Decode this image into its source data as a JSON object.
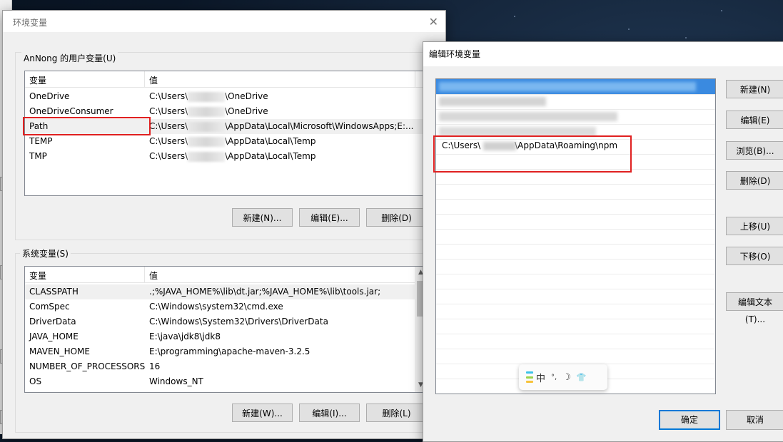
{
  "env_window": {
    "title": "环境变量",
    "close_glyph": "✕",
    "user_group": "AnNong 的用户变量(U)",
    "system_group": "系统变量(S)",
    "col_var": "变量",
    "col_val": "值",
    "user_rows": [
      {
        "name": "OneDrive",
        "pre": "C:\\Users\\",
        "post": "\\OneDrive"
      },
      {
        "name": "OneDriveConsumer",
        "pre": "C:\\Users\\",
        "post": "\\OneDrive"
      },
      {
        "name": "Path",
        "pre": "C:\\Users\\",
        "post": "\\AppData\\Local\\Microsoft\\WindowsApps;E:..."
      },
      {
        "name": "TEMP",
        "pre": "C:\\Users\\",
        "post": "\\AppData\\Local\\Temp"
      },
      {
        "name": "TMP",
        "pre": "C:\\Users\\",
        "post": "\\AppData\\Local\\Temp"
      }
    ],
    "system_rows": [
      {
        "name": "CLASSPATH",
        "value": ".;%JAVA_HOME%\\lib\\dt.jar;%JAVA_HOME%\\lib\\tools.jar;"
      },
      {
        "name": "ComSpec",
        "value": "C:\\Windows\\system32\\cmd.exe"
      },
      {
        "name": "DriverData",
        "value": "C:\\Windows\\System32\\Drivers\\DriverData"
      },
      {
        "name": "JAVA_HOME",
        "value": "E:\\java\\jdk8\\jdk8"
      },
      {
        "name": "MAVEN_HOME",
        "value": "E:\\programming\\apache-maven-3.2.5"
      },
      {
        "name": "NUMBER_OF_PROCESSORS",
        "value": "16"
      },
      {
        "name": "OS",
        "value": "Windows_NT"
      }
    ],
    "user_buttons": {
      "new": "新建(N)...",
      "edit": "编辑(E)...",
      "delete": "删除(D)"
    },
    "system_buttons": {
      "new": "新建(W)...",
      "edit": "编辑(I)...",
      "delete": "删除(L)"
    }
  },
  "edit_window": {
    "title": "编辑环境变量",
    "visible_entry": "C:\\Users\\",
    "visible_entry_post": "\\AppData\\Roaming\\npm",
    "buttons": {
      "new": "新建(N)",
      "edit": "编辑(E)",
      "browse": "浏览(B)...",
      "delete": "删除(D)",
      "move_up": "上移(U)",
      "move_down": "下移(O)",
      "edit_text": "编辑文本(T)...",
      "ok": "确定",
      "cancel": "取消"
    }
  },
  "ime_toolbar": {
    "mode": "中",
    "punct_icon": "°,",
    "halfwidth_icon": "☽",
    "skin_icon": "👕"
  },
  "colors": {
    "selection_blue": "#0078d7",
    "highlight_red": "#e02020"
  }
}
